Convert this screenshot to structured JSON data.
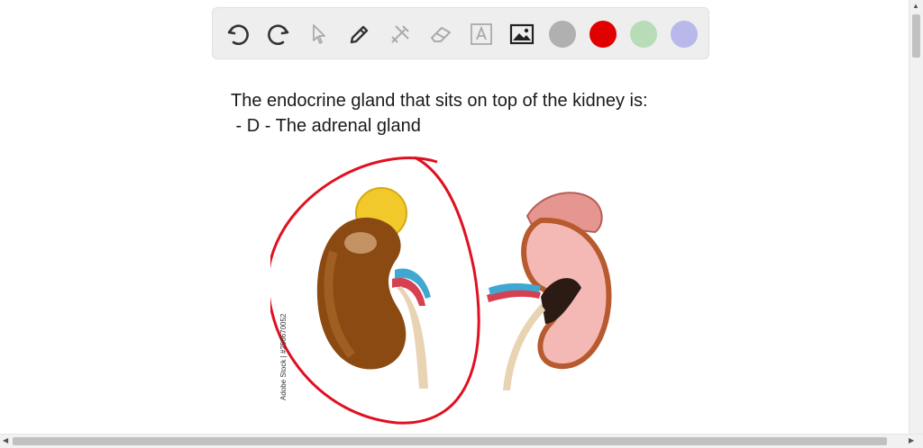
{
  "toolbar": {
    "tools": [
      "undo-icon",
      "redo-icon",
      "pointer-icon",
      "pen-icon",
      "tools-icon",
      "eraser-icon",
      "text-icon",
      "image-icon"
    ],
    "colors": [
      "#b0b0b0",
      "#e00000",
      "#b8dcb8",
      "#b8b8ea"
    ]
  },
  "canvas": {
    "line1": "The endocrine gland that sits on top of the kidney is:",
    "line2": " - D - The adrenal gland",
    "image_credit": "Adobe Stock | #256670052"
  },
  "annotation": {
    "color": "#e01020"
  }
}
